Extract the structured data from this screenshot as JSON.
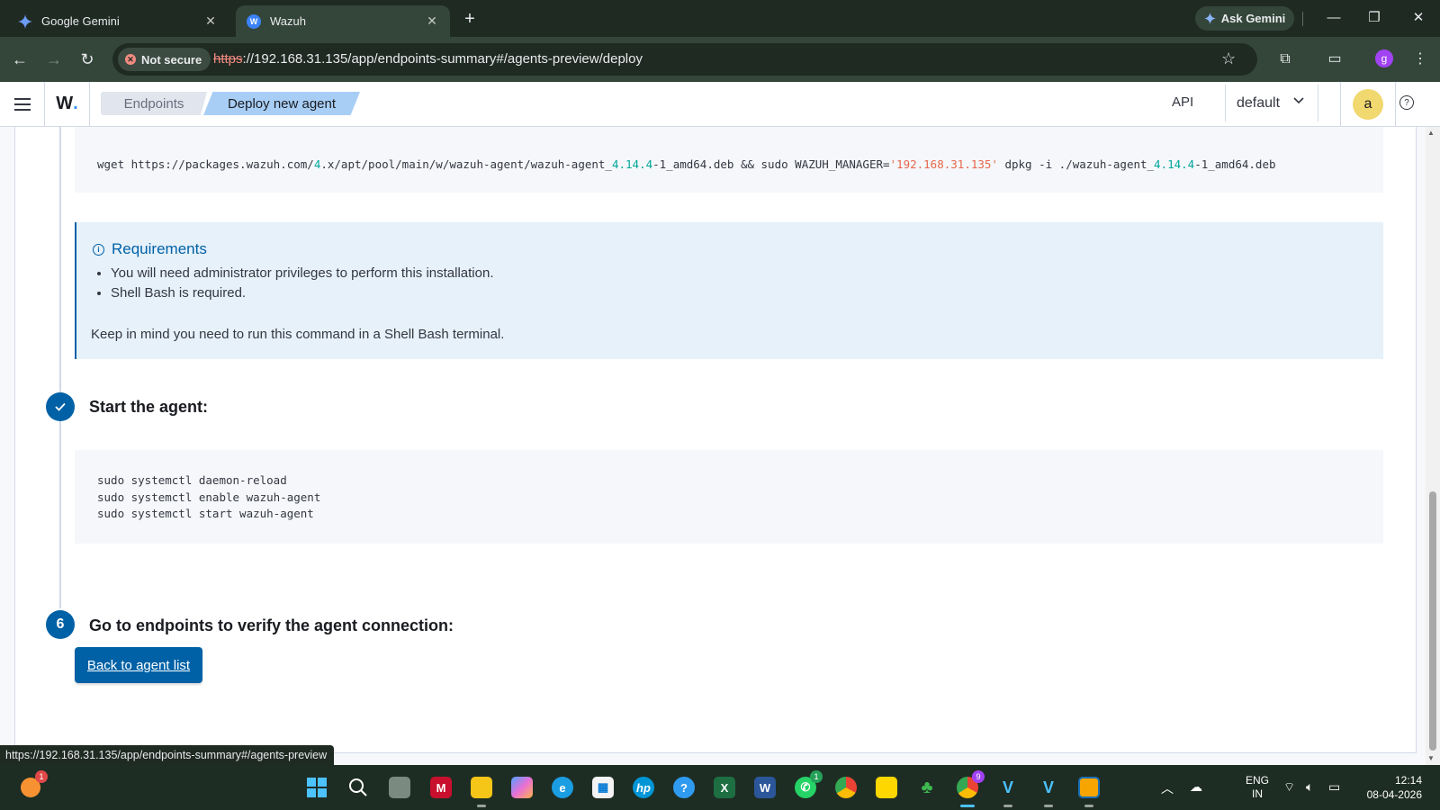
{
  "browser": {
    "tabs": [
      {
        "title": "Google Gemini",
        "active": false
      },
      {
        "title": "Wazuh",
        "active": true
      }
    ],
    "ask_gemini_label": "Ask Gemini",
    "security_label": "Not secure",
    "url_scheme": "https",
    "url_rest": "://192.168.31.135/app/endpoints-summary#/agents-preview/deploy",
    "profile_initial": "g",
    "status_url": "https://192.168.31.135/app/endpoints-summary#/agents-preview"
  },
  "header": {
    "logo_text": "W",
    "logo_dot": ".",
    "breadcrumbs": [
      "Endpoints",
      "Deploy new agent"
    ],
    "api_label": "API",
    "selector_value": "default",
    "avatar_initial": "a"
  },
  "install_command": {
    "parts": [
      {
        "t": "wget https://packages.wazuh.com/",
        "c": "plain"
      },
      {
        "t": "4",
        "c": "num"
      },
      {
        "t": ".x/apt/pool/main/w/wazuh-agent/wazuh-agent_",
        "c": "plain"
      },
      {
        "t": "4.14.4",
        "c": "num"
      },
      {
        "t": "-1_amd64.deb && sudo WAZUH_MANAGER=",
        "c": "plain"
      },
      {
        "t": "'192.168.31.135'",
        "c": "str"
      },
      {
        "t": " dpkg -i ./wazuh-agent_",
        "c": "plain"
      },
      {
        "t": "4.14.4",
        "c": "num"
      },
      {
        "t": "-1_amd64.deb",
        "c": "plain"
      }
    ]
  },
  "requirements": {
    "title": "Requirements",
    "items": [
      "You will need administrator privileges to perform this installation.",
      "Shell Bash is required."
    ],
    "note": "Keep in mind you need to run this command in a Shell Bash terminal."
  },
  "step5": {
    "title": "Start the agent:",
    "commands": [
      "sudo systemctl daemon-reload",
      "sudo systemctl enable wazuh-agent",
      "sudo systemctl start wazuh-agent"
    ]
  },
  "step6": {
    "number": "6",
    "title": "Go to endpoints to verify the agent connection:",
    "button_label": "Back to agent list"
  },
  "taskbar": {
    "notif_badge": "1",
    "whatsapp_badge": "1",
    "chrome_badge": "9",
    "lang_line1": "ENG",
    "lang_line2": "IN",
    "time": "12:14",
    "date": "08-04-2026"
  },
  "colors": {
    "accent": "#0061a6",
    "code_number": "#00a69b",
    "code_string": "#e7664c",
    "chrome_dark": "#1f2a23",
    "chrome_toolbar": "#34463a"
  }
}
